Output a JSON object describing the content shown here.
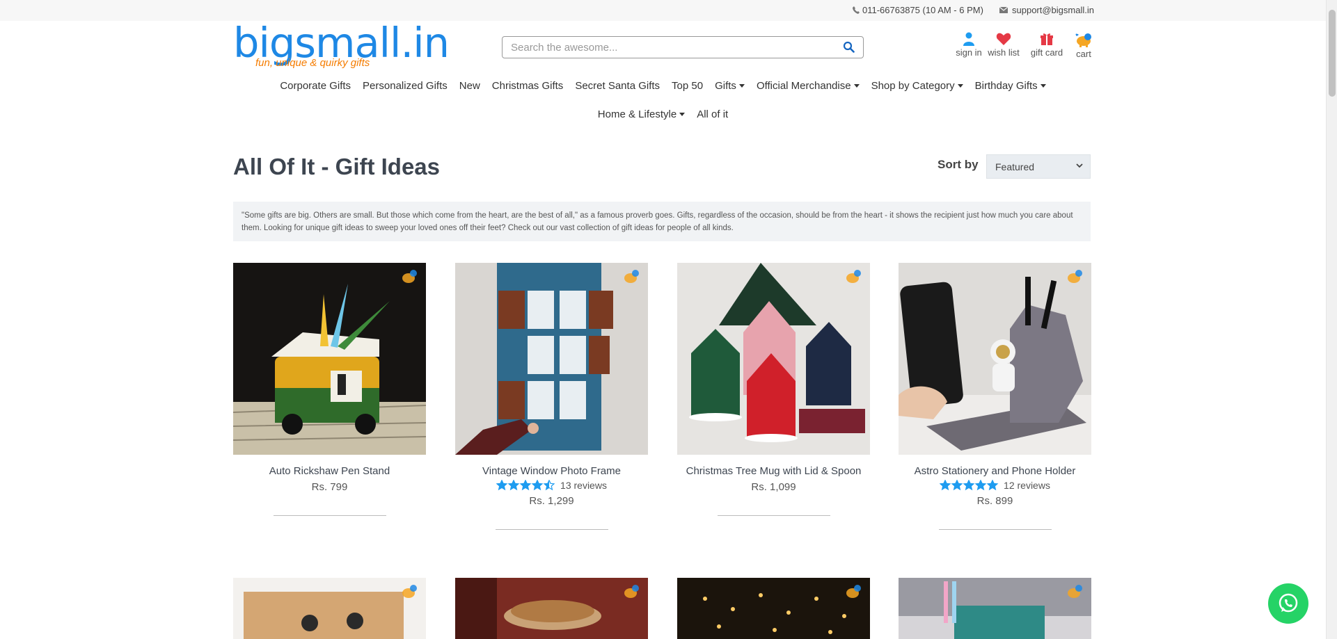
{
  "topbar": {
    "phone": "011-66763875 (10 AM - 6 PM)",
    "email": "support@bigsmall.in"
  },
  "logo": {
    "name": "bigsmall.in",
    "tagline": "fun, unique & quirky gifts"
  },
  "search": {
    "placeholder": "Search the awesome..."
  },
  "header_links": {
    "sign_in": "sign in",
    "wish_list": "wish list",
    "gift_card": "gift card",
    "cart": "cart"
  },
  "nav": {
    "row1": [
      {
        "label": "Corporate Gifts",
        "dropdown": false
      },
      {
        "label": "Personalized Gifts",
        "dropdown": false
      },
      {
        "label": "New",
        "dropdown": false
      },
      {
        "label": "Christmas Gifts",
        "dropdown": false
      },
      {
        "label": "Secret Santa Gifts",
        "dropdown": false
      },
      {
        "label": "Top 50",
        "dropdown": false
      },
      {
        "label": "Gifts",
        "dropdown": true
      },
      {
        "label": "Official Merchandise",
        "dropdown": true
      },
      {
        "label": "Shop by Category",
        "dropdown": true
      },
      {
        "label": "Birthday Gifts",
        "dropdown": true
      }
    ],
    "row2": [
      {
        "label": "Home & Lifestyle",
        "dropdown": true
      },
      {
        "label": "All of it",
        "dropdown": false
      }
    ]
  },
  "page": {
    "title": "All Of It - Gift Ideas",
    "sort_label": "Sort by",
    "sort_value": "Featured",
    "description": "\"Some gifts are big. Others are small. But those which come from the heart, are the best of all,\" as a famous proverb goes. Gifts, regardless of the occasion, should be from the heart - it shows the recipient just how much you care about them. Looking for unique gift ideas to sweep your loved ones off their feet? Check out our vast collection of gift ideas for people of all kinds."
  },
  "products": [
    {
      "name": "Auto Rickshaw Pen Stand",
      "price": "Rs. 799",
      "rating": null,
      "reviews": ""
    },
    {
      "name": "Vintage Window Photo Frame",
      "price": "Rs. 1,299",
      "rating": 4.5,
      "reviews": "13 reviews"
    },
    {
      "name": "Christmas Tree Mug with Lid & Spoon",
      "price": "Rs. 1,099",
      "rating": null,
      "reviews": ""
    },
    {
      "name": "Astro Stationery and Phone Holder",
      "price": "Rs. 899",
      "rating": 5,
      "reviews": "12 reviews"
    }
  ],
  "icons": [
    "phone-icon",
    "mail-icon",
    "search-icon",
    "user-icon",
    "heart-icon",
    "gift-icon",
    "cart-icon",
    "star-icon",
    "whatsapp-icon"
  ],
  "colors": {
    "brand_blue": "#1e88e5",
    "brand_orange": "#f57c00",
    "star": "#1e9cf0",
    "whatsapp": "#25d366"
  }
}
